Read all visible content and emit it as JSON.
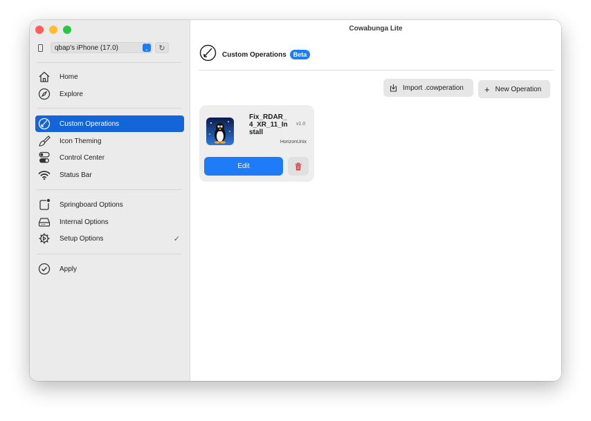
{
  "window": {
    "title": "Cowabunga Lite"
  },
  "device": {
    "selected": "qbap's iPhone (17.0)",
    "refresh_icon": "refresh-icon"
  },
  "sidebar": {
    "group1": [
      {
        "label": "Home",
        "icon": "house-icon"
      },
      {
        "label": "Explore",
        "icon": "compass-icon"
      }
    ],
    "group2": [
      {
        "label": "Custom Operations",
        "icon": "custom-operations-icon",
        "active": true
      },
      {
        "label": "Icon Theming",
        "icon": "paintbrush-icon"
      },
      {
        "label": "Control Center",
        "icon": "toggles-icon"
      },
      {
        "label": "Status Bar",
        "icon": "wifi-icon"
      }
    ],
    "group3": [
      {
        "label": "Springboard Options",
        "icon": "app-badge-icon"
      },
      {
        "label": "Internal Options",
        "icon": "internal-drive-icon"
      },
      {
        "label": "Setup Options",
        "icon": "gear-icon",
        "checked": true
      }
    ],
    "group4": [
      {
        "label": "Apply",
        "icon": "checkmark-circle-icon"
      }
    ]
  },
  "main": {
    "title": "Custom Operations",
    "badge": "Beta",
    "import_label": "Import .cowperation",
    "new_label": "New Operation",
    "new_prefix": "+",
    "operations": [
      {
        "name": "Fix_RDAR_4_XR_11_Install",
        "version": "v1.0",
        "author": "HorizonUnix",
        "edit_label": "Edit"
      }
    ]
  },
  "colors": {
    "accent": "#1e7cf8",
    "selection": "#1465d8",
    "delete": "#e5373a"
  }
}
